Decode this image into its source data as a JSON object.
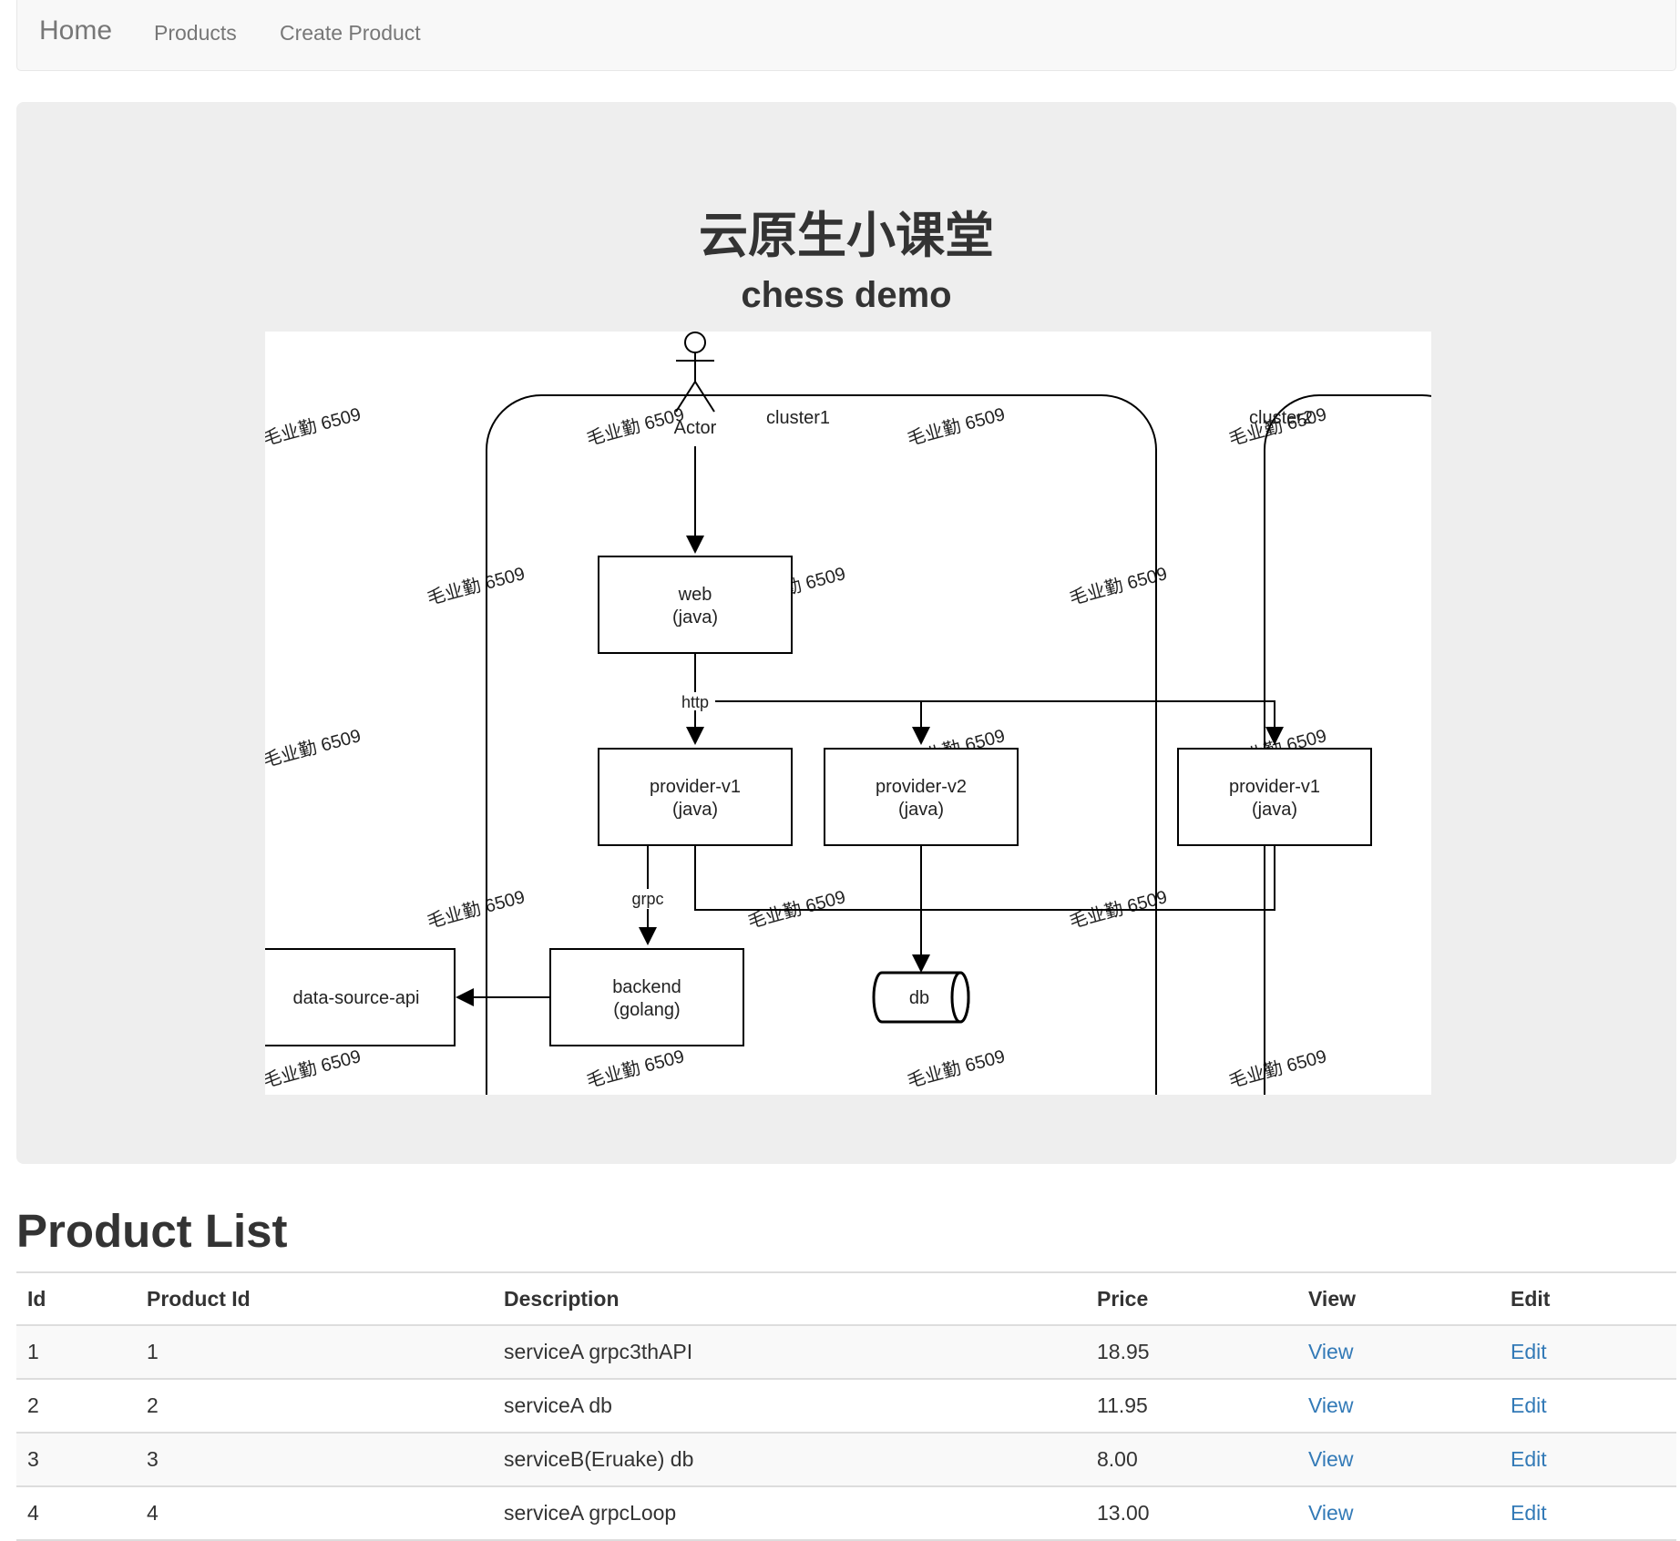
{
  "navbar": {
    "brand": "Home",
    "links": [
      "Products",
      "Create Product"
    ]
  },
  "jumbotron": {
    "title": "云原生小课堂",
    "subtitle": "chess demo"
  },
  "diagram": {
    "actor": "Actor",
    "clusters": [
      "cluster1",
      "cluster2"
    ],
    "nodes": {
      "web": [
        "web",
        "(java)"
      ],
      "provider_v1": [
        "provider-v1",
        "(java)"
      ],
      "provider_v2": [
        "provider-v2",
        "(java)"
      ],
      "provider_v1_c2": [
        "provider-v1",
        "(java)"
      ],
      "backend": [
        "backend",
        "(golang)"
      ],
      "data_source": "data-source-api",
      "db": "db"
    },
    "edge_labels": {
      "http": "http",
      "grpc": "grpc"
    },
    "watermark": "毛业勤 6509"
  },
  "product_list": {
    "title": "Product List",
    "columns": [
      "Id",
      "Product Id",
      "Description",
      "Price",
      "View",
      "Edit"
    ],
    "rows": [
      {
        "id": "1",
        "product_id": "1",
        "description": "serviceA grpc3thAPI",
        "price": "18.95",
        "view": "View",
        "edit": "Edit"
      },
      {
        "id": "2",
        "product_id": "2",
        "description": "serviceA db",
        "price": "11.95",
        "view": "View",
        "edit": "Edit"
      },
      {
        "id": "3",
        "product_id": "3",
        "description": "serviceB(Eruake) db",
        "price": "8.00",
        "view": "View",
        "edit": "Edit"
      },
      {
        "id": "4",
        "product_id": "4",
        "description": "serviceA grpcLoop",
        "price": "13.00",
        "view": "View",
        "edit": "Edit"
      }
    ]
  }
}
